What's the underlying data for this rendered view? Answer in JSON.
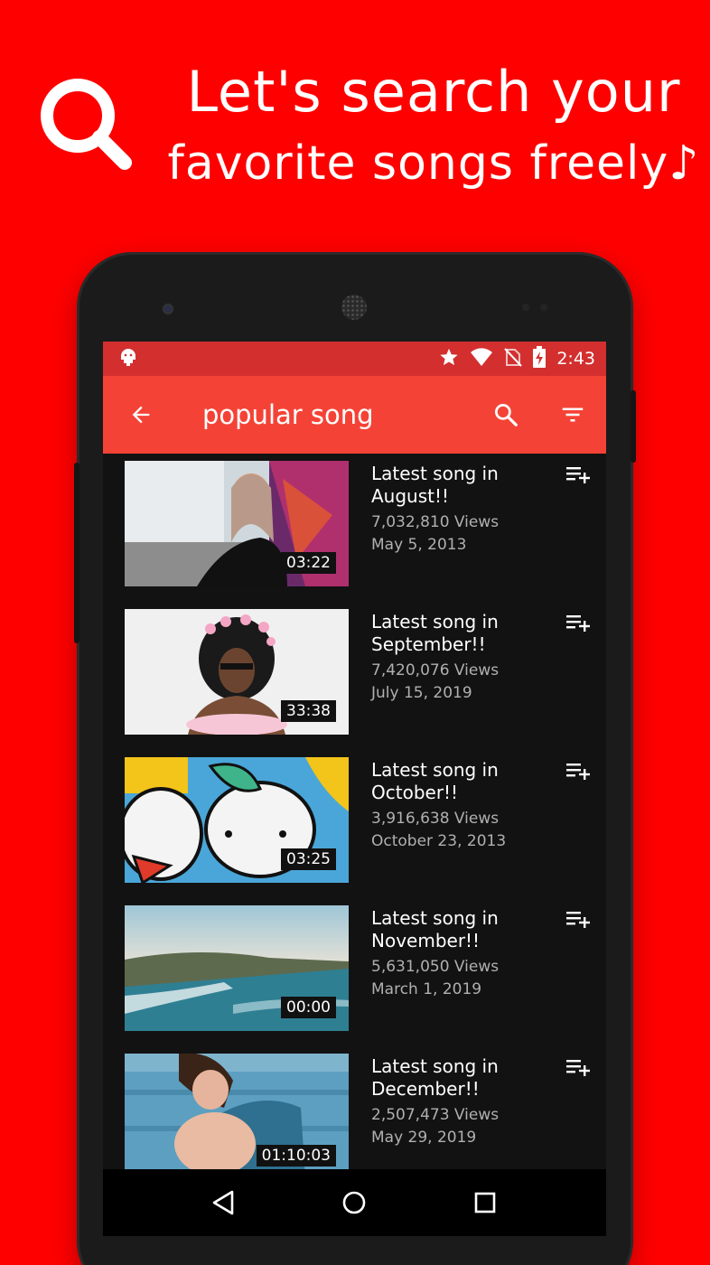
{
  "promo": {
    "line1": "Let's search your",
    "line2": "favorite songs freely♪"
  },
  "status_bar": {
    "time": "2:43",
    "icons": [
      "android-icon",
      "star-icon",
      "wifi-icon",
      "no-sim-icon",
      "battery-charging-icon"
    ]
  },
  "app_bar": {
    "title": "popular song",
    "icons": [
      "back-arrow-icon",
      "search-icon",
      "filter-icon"
    ]
  },
  "videos": [
    {
      "title": "Latest song in August!!",
      "views": "7,032,810 Views",
      "date": "May 5, 2013",
      "duration": "03:22"
    },
    {
      "title": "Latest song in September!!",
      "views": "7,420,076 Views",
      "date": "July 15, 2019",
      "duration": "33:38"
    },
    {
      "title": "Latest song in October!!",
      "views": "3,916,638 Views",
      "date": "October 23, 2013",
      "duration": "03:25"
    },
    {
      "title": "Latest song in November!!",
      "views": "5,631,050 Views",
      "date": "March 1, 2019",
      "duration": "00:00"
    },
    {
      "title": "Latest song in December!!",
      "views": "2,507,473 Views",
      "date": "May 29, 2019",
      "duration": "01:10:03"
    }
  ],
  "nav_bar": {
    "icons": [
      "back-triangle-icon",
      "home-circle-icon",
      "recents-square-icon"
    ]
  },
  "colors": {
    "background": "#fe0000",
    "status_bar": "#d32f2f",
    "app_bar": "#f44336",
    "list_background": "#121212"
  }
}
